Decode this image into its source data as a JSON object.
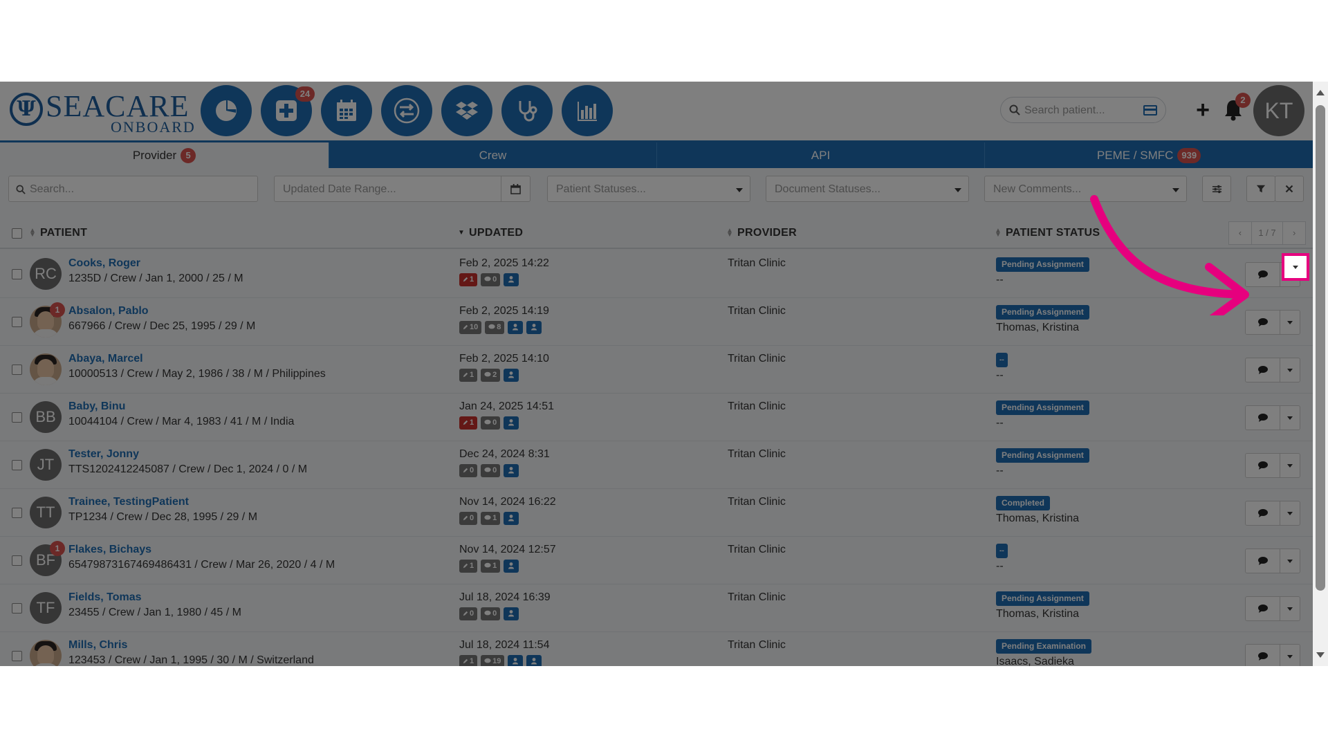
{
  "brand": {
    "name_top": "SEACARE",
    "name_bottom": "ONBOARD"
  },
  "nav": {
    "buttons": [
      {
        "name": "dashboard-icon",
        "badge": ""
      },
      {
        "name": "add-record-icon",
        "badge": "24"
      },
      {
        "name": "calendar-icon",
        "badge": ""
      },
      {
        "name": "transfer-icon",
        "badge": ""
      },
      {
        "name": "dropbox-icon",
        "badge": ""
      },
      {
        "name": "stethoscope-icon",
        "badge": ""
      },
      {
        "name": "bar-chart-icon",
        "badge": ""
      }
    ]
  },
  "header": {
    "search_placeholder": "Search patient...",
    "notifications": "2",
    "user_initials": "KT"
  },
  "tabs": [
    {
      "label": "Provider",
      "badge": "5",
      "active": true
    },
    {
      "label": "Crew",
      "badge": "",
      "active": false
    },
    {
      "label": "API",
      "badge": "",
      "active": false
    },
    {
      "label": "PEME / SMFC",
      "badge": "939",
      "active": false
    }
  ],
  "filters": {
    "search_placeholder": "Search...",
    "date_placeholder": "Updated Date Range...",
    "patient_status_placeholder": "Patient Statuses...",
    "document_status_placeholder": "Document Statuses...",
    "comments_placeholder": "New Comments..."
  },
  "table": {
    "columns": {
      "patient": "PATIENT",
      "updated": "UPDATED",
      "provider": "PROVIDER",
      "status": "PATIENT STATUS"
    },
    "pager": {
      "prev": "‹",
      "page": "1 / 7",
      "next": "›"
    },
    "rows": [
      {
        "initials": "RC",
        "photo": false,
        "badge": "",
        "name": "Cooks, Roger",
        "info": "1235D / Crew / Jan 1, 2000 / 25 / M",
        "updated": "Feb 2, 2025 14:22",
        "docs": "1",
        "docs_red": true,
        "comments": "0",
        "users": 1,
        "provider": "Tritan Clinic",
        "status": "Pending Assignment",
        "assignee": "--"
      },
      {
        "initials": "",
        "photo": true,
        "badge": "1",
        "name": "Absalon, Pablo",
        "info": "667966 / Crew / Dec 25, 1995 / 29 / M",
        "updated": "Feb 2, 2025 14:19",
        "docs": "10",
        "docs_red": false,
        "comments": "8",
        "users": 2,
        "provider": "Tritan Clinic",
        "status": "Pending Assignment",
        "assignee": "Thomas, Kristina"
      },
      {
        "initials": "",
        "photo": true,
        "badge": "",
        "name": "Abaya, Marcel",
        "info": "10000513 / Crew / May 2, 1986 / 38 / M / Philippines",
        "updated": "Feb 2, 2025 14:10",
        "docs": "1",
        "docs_red": false,
        "comments": "2",
        "users": 1,
        "provider": "Tritan Clinic",
        "status": "--",
        "assignee": "--"
      },
      {
        "initials": "BB",
        "photo": false,
        "badge": "",
        "name": "Baby, Binu",
        "info": "10044104 / Crew / Mar 4, 1983 / 41 / M / India",
        "updated": "Jan 24, 2025 14:51",
        "docs": "1",
        "docs_red": true,
        "comments": "0",
        "users": 1,
        "provider": "Tritan Clinic",
        "status": "Pending Assignment",
        "assignee": "--"
      },
      {
        "initials": "JT",
        "photo": false,
        "badge": "",
        "name": "Tester, Jonny",
        "info": "TTS1202412245087 / Crew / Dec 1, 2024 / 0 / M",
        "updated": "Dec 24, 2024 8:31",
        "docs": "0",
        "docs_red": false,
        "comments": "0",
        "users": 1,
        "provider": "Tritan Clinic",
        "status": "Pending Assignment",
        "assignee": "--"
      },
      {
        "initials": "TT",
        "photo": false,
        "badge": "",
        "name": "Trainee, TestingPatient",
        "info": "TP1234 / Crew / Dec 28, 1995 / 29 / M",
        "updated": "Nov 14, 2024 16:22",
        "docs": "0",
        "docs_red": false,
        "comments": "1",
        "users": 1,
        "provider": "Tritan Clinic",
        "status": "Completed",
        "assignee": "Thomas, Kristina"
      },
      {
        "initials": "BF",
        "photo": false,
        "badge": "1",
        "name": "Flakes, Bichays",
        "info": "654798731674694864​31 / Crew / Mar 26, 2020 / 4 / M",
        "updated": "Nov 14, 2024 12:57",
        "docs": "1",
        "docs_red": false,
        "comments": "1",
        "users": 1,
        "provider": "Tritan Clinic",
        "status": "--",
        "assignee": "--"
      },
      {
        "initials": "TF",
        "photo": false,
        "badge": "",
        "name": "Fields, Tomas",
        "info": "23455 / Crew / Jan 1, 1980 / 45 / M",
        "updated": "Jul 18, 2024 16:39",
        "docs": "0",
        "docs_red": false,
        "comments": "0",
        "users": 1,
        "provider": "Tritan Clinic",
        "status": "Pending Assignment",
        "assignee": "Thomas, Kristina"
      },
      {
        "initials": "",
        "photo": true,
        "badge": "",
        "name": "Mills, Chris",
        "info": "123453 / Crew / Jan 1, 1995 / 30 / M / Switzerland",
        "updated": "Jul 18, 2024 11:54",
        "docs": "1",
        "docs_red": false,
        "comments": "19",
        "users": 2,
        "provider": "Tritan Clinic",
        "status": "Pending Examination",
        "assignee": "Isaacs, Sadieka"
      }
    ]
  },
  "colors": {
    "primary": "#1f6db3",
    "danger": "#d9534f",
    "highlight": "#e6007e"
  }
}
